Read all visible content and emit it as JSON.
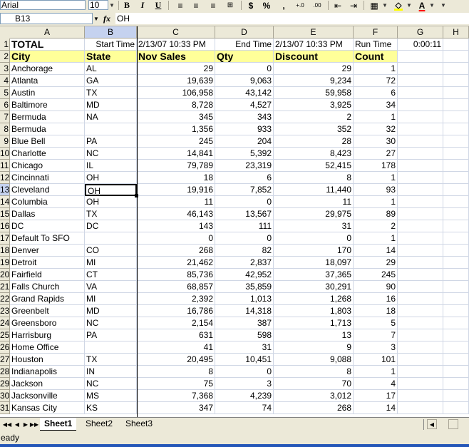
{
  "toolbar": {
    "font_name": "Arial",
    "font_size": "10",
    "bold": "B",
    "italic": "I",
    "underline": "U",
    "currency": "$",
    "percent": "%",
    "comma": ",",
    "inc_decimal": "+.0",
    "dec_decimal": ".00",
    "font_color_label": "A"
  },
  "formula_bar": {
    "name_box": "B13",
    "fx": "fx",
    "formula": "OH"
  },
  "columns": [
    "A",
    "B",
    "C",
    "D",
    "E",
    "F",
    "G",
    "H"
  ],
  "row_numbers": [
    "1",
    "2",
    "3",
    "4",
    "5",
    "6",
    "7",
    "8",
    "9",
    "10",
    "11",
    "12",
    "13",
    "14",
    "15",
    "16",
    "17",
    "18",
    "19",
    "20",
    "21",
    "22",
    "23",
    "24",
    "25",
    "26",
    "27",
    "28",
    "29",
    "30",
    "31"
  ],
  "row1": {
    "total": "TOTAL",
    "start_time_label": "Start Time",
    "start_time": "2/13/07 10:33 PM",
    "end_time_label": "End Time",
    "end_time": "2/13/07 10:33 PM",
    "run_time_label": "Run Time",
    "run_time": "0:00:11"
  },
  "headers": [
    "City",
    "State",
    "Nov Sales",
    "Qty",
    "Discount",
    "Count"
  ],
  "rows": [
    [
      "Anchorage",
      "AL",
      "29",
      "0",
      "29",
      "1"
    ],
    [
      "Atlanta",
      "GA",
      "19,639",
      "9,063",
      "9,234",
      "72"
    ],
    [
      "Austin",
      "TX",
      "106,958",
      "43,142",
      "59,958",
      "6"
    ],
    [
      "Baltimore",
      "MD",
      "8,728",
      "4,527",
      "3,925",
      "34"
    ],
    [
      "Bermuda",
      "NA",
      "345",
      "343",
      "2",
      "1"
    ],
    [
      "Bermuda",
      "",
      "1,356",
      "933",
      "352",
      "32"
    ],
    [
      "Blue Bell",
      "PA",
      "245",
      "204",
      "28",
      "30"
    ],
    [
      "Charlotte",
      "NC",
      "14,841",
      "5,392",
      "8,423",
      "27"
    ],
    [
      "Chicago",
      "IL",
      "79,789",
      "23,319",
      "52,415",
      "178"
    ],
    [
      "Cincinnati",
      "OH",
      "18",
      "6",
      "8",
      "1"
    ],
    [
      "Cleveland",
      "OH",
      "19,916",
      "7,852",
      "11,440",
      "93"
    ],
    [
      "Columbia",
      "OH",
      "11",
      "0",
      "11",
      "1"
    ],
    [
      "Dallas",
      "TX",
      "46,143",
      "13,567",
      "29,975",
      "89"
    ],
    [
      "DC",
      "DC",
      "143",
      "111",
      "31",
      "2"
    ],
    [
      "Default To SFO",
      "",
      "0",
      "0",
      "0",
      "1"
    ],
    [
      "Denver",
      "CO",
      "268",
      "82",
      "170",
      "14"
    ],
    [
      "Detroit",
      "MI",
      "21,462",
      "2,837",
      "18,097",
      "29"
    ],
    [
      "Fairfield",
      "CT",
      "85,736",
      "42,952",
      "37,365",
      "245"
    ],
    [
      "Falls Church",
      "VA",
      "68,857",
      "35,859",
      "30,291",
      "90"
    ],
    [
      "Grand Rapids",
      "MI",
      "2,392",
      "1,013",
      "1,268",
      "16"
    ],
    [
      "Greenbelt",
      "MD",
      "16,786",
      "14,318",
      "1,803",
      "18"
    ],
    [
      "Greensboro",
      "NC",
      "2,154",
      "387",
      "1,713",
      "5"
    ],
    [
      "Harrisburg",
      "PA",
      "631",
      "598",
      "13",
      "7"
    ],
    [
      "Home Office",
      "",
      "41",
      "31",
      "9",
      "3"
    ],
    [
      "Houston",
      "TX",
      "20,495",
      "10,451",
      "9,088",
      "101"
    ],
    [
      "Indianapolis",
      "IN",
      "8",
      "0",
      "8",
      "1"
    ],
    [
      "Jackson",
      "NC",
      "75",
      "3",
      "70",
      "4"
    ],
    [
      "Jacksonville",
      "MS",
      "7,368",
      "4,239",
      "3,012",
      "17"
    ],
    [
      "Kansas City",
      "KS",
      "347",
      "74",
      "268",
      "14"
    ]
  ],
  "sheets": [
    "Sheet1",
    "Sheet2",
    "Sheet3"
  ],
  "status": "eady",
  "colors": {
    "header_fill": "#ffff99",
    "selection": "#c5d2ef",
    "status_accent": "#2456b8"
  }
}
